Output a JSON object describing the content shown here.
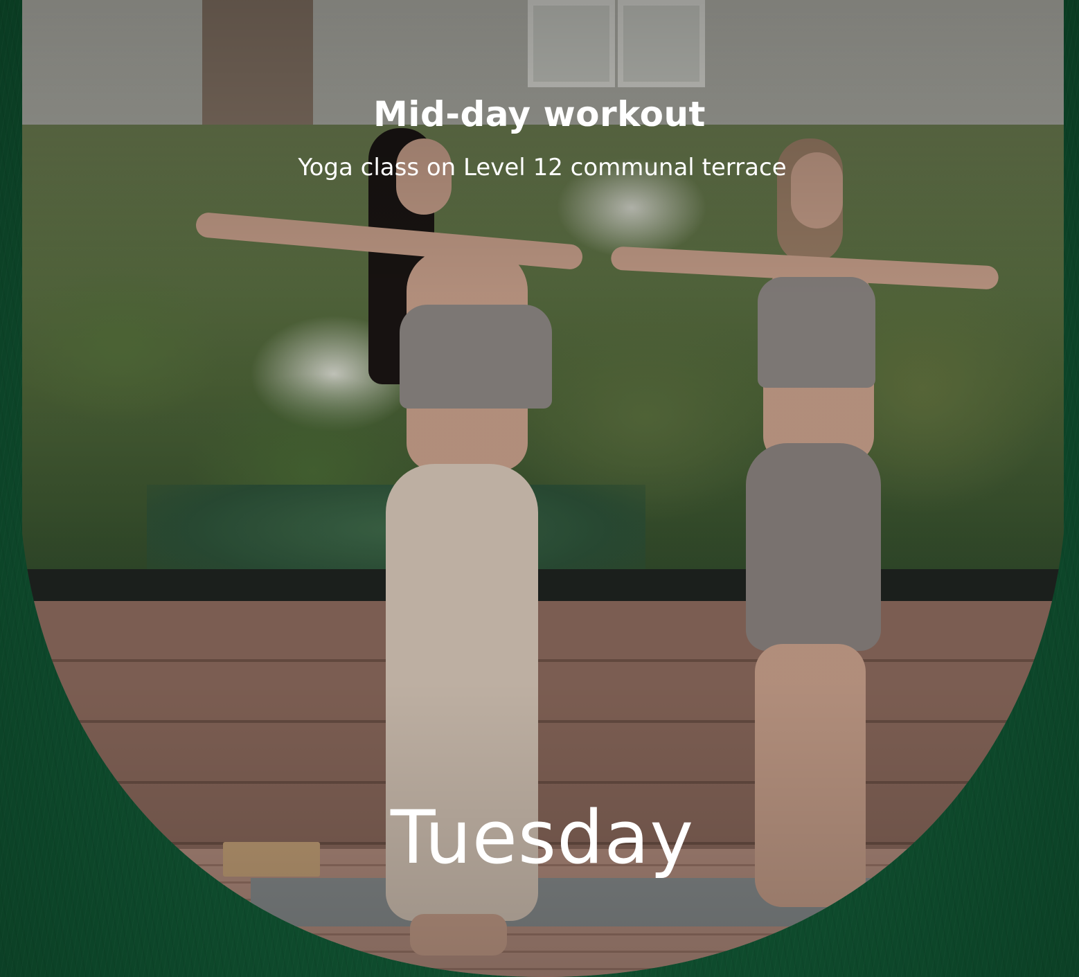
{
  "card": {
    "title": "Mid-day workout",
    "subtitle": "Yoga class on Level 12 communal terrace",
    "day": "Tuesday"
  },
  "colors": {
    "background_green": "#0f4a2e",
    "text": "#ffffff"
  }
}
